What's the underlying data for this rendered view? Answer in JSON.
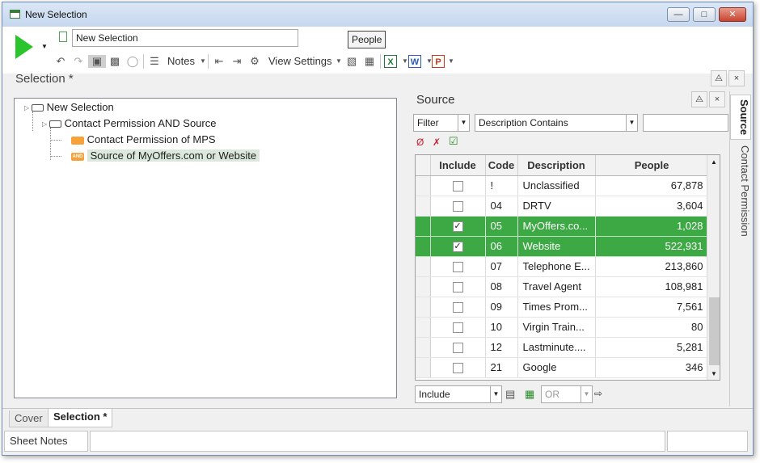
{
  "window": {
    "title": "New Selection",
    "controls": [
      "minimize",
      "maximize",
      "close"
    ]
  },
  "toolbar": {
    "selection_name": "New Selection",
    "people_button": "People",
    "notes_label": "Notes",
    "view_settings_label": "View Settings",
    "icons": [
      "run-icon",
      "undo-icon",
      "redo-icon",
      "lock-icon",
      "save-icon",
      "database-icon",
      "notes-icon",
      "indent-icon",
      "outdent-icon",
      "settings-icon",
      "tree-icon",
      "grid-icon",
      "excel-icon",
      "word-icon",
      "powerpoint-icon"
    ]
  },
  "selection": {
    "heading": "Selection *",
    "tree": [
      {
        "label": "New Selection",
        "level": 0,
        "icon": "node-box-icon"
      },
      {
        "label": "Contact Permission AND Source",
        "level": 1,
        "icon": "node-box-icon"
      },
      {
        "label": "Contact Permission of MPS",
        "level": 2,
        "icon": "criteria-icon"
      },
      {
        "label": "Source of MyOffers.com or Website",
        "level": 2,
        "icon": "and-icon",
        "selected": true
      }
    ]
  },
  "source_panel": {
    "title": "Source",
    "filter_label": "Filter",
    "mode_label": "Description Contains",
    "search_value": "",
    "columns": [
      "Include",
      "Code",
      "Description",
      "People"
    ],
    "rows": [
      {
        "include": false,
        "code": "!",
        "description": "Unclassified",
        "people": "67,878"
      },
      {
        "include": false,
        "code": "04",
        "description": "DRTV",
        "people": "3,604"
      },
      {
        "include": true,
        "code": "05",
        "description": "MyOffers.co...",
        "people": "1,028"
      },
      {
        "include": true,
        "code": "06",
        "description": "Website",
        "people": "522,931"
      },
      {
        "include": false,
        "code": "07",
        "description": "Telephone E...",
        "people": "213,860"
      },
      {
        "include": false,
        "code": "08",
        "description": "Travel Agent",
        "people": "108,981"
      },
      {
        "include": false,
        "code": "09",
        "description": "Times Prom...",
        "people": "7,561"
      },
      {
        "include": false,
        "code": "10",
        "description": "Virgin Train...",
        "people": "80"
      },
      {
        "include": false,
        "code": "12",
        "description": "Lastminute....",
        "people": "5,281"
      },
      {
        "include": false,
        "code": "21",
        "description": "Google",
        "people": "346"
      }
    ],
    "include_combo": "Include",
    "or_combo": "OR"
  },
  "side_tabs": [
    "Source",
    "Contact Permission"
  ],
  "bottom_tabs": [
    "Cover",
    "Selection *"
  ],
  "status": {
    "sheet_notes": "Sheet Notes"
  },
  "colors": {
    "selected_row": "#3da944",
    "run": "#2cc42c",
    "criteria": "#f5a23c"
  }
}
